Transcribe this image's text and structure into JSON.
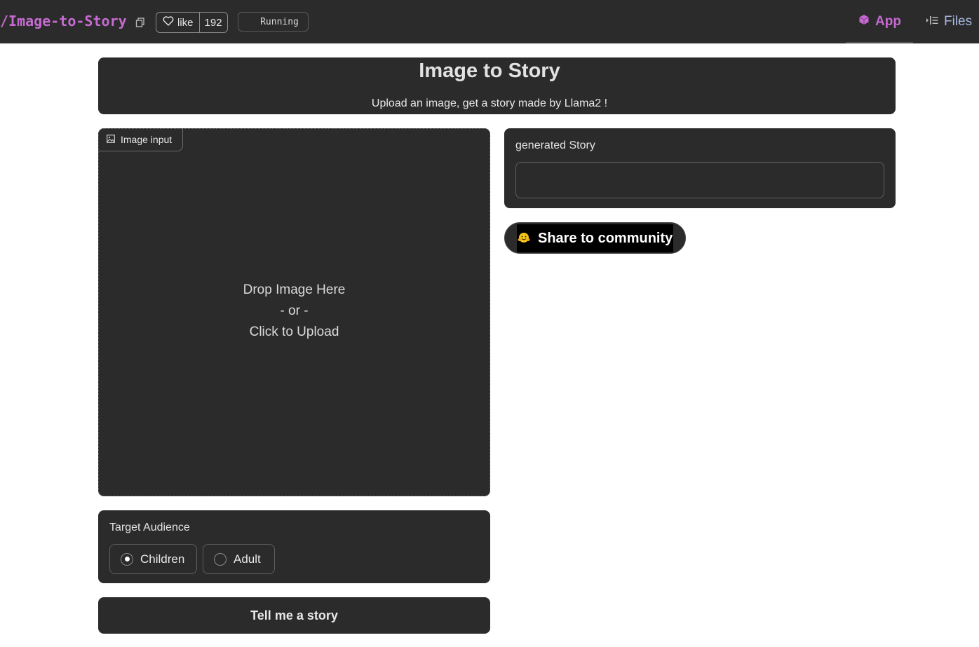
{
  "topbar": {
    "repo_title": "/Image-to-Story",
    "like_label": "like",
    "like_count": "192",
    "status": "Running",
    "nav": {
      "app_label": "App",
      "files_label": "Files"
    }
  },
  "header": {
    "title": "Image to Story",
    "subtitle": "Upload an image, get a story made by Llama2 !"
  },
  "image_input": {
    "tab_label": "Image input",
    "drop_line1": "Drop Image Here",
    "drop_line2": "- or -",
    "drop_line3": "Click to Upload"
  },
  "story_output": {
    "label": "generated Story",
    "value": ""
  },
  "share": {
    "label": "Share to community"
  },
  "audience": {
    "label": "Target Audience",
    "options": [
      "Children",
      "Adult"
    ],
    "selected": "Children"
  },
  "submit": {
    "label": "Tell me a story"
  },
  "colors": {
    "accent": "#c56bd0",
    "panel_bg": "#2b2b2b",
    "page_bg": "#ffffff"
  }
}
